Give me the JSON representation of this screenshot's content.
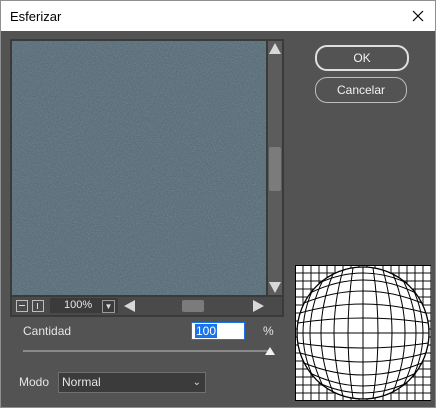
{
  "window": {
    "title": "Esferizar"
  },
  "buttons": {
    "ok_label": "OK",
    "cancel_label": "Cancelar"
  },
  "preview": {
    "zoom": "100%"
  },
  "amount": {
    "label": "Cantidad",
    "value": "100",
    "unit": "%",
    "slider_level_percent": 100
  },
  "mode": {
    "label": "Modo",
    "selected": "Normal"
  },
  "colors": {
    "dialog_background": "#535353",
    "preview_texture": "#5a7481",
    "titlebar": "#ffffff",
    "input_highlight": "#1a73e8"
  },
  "icons": {
    "close": "close-icon",
    "scroll_up": "up-arrow-icon",
    "scroll_down": "down-arrow-icon",
    "scroll_left": "left-arrow-icon",
    "scroll_right": "right-arrow-icon",
    "zoom_out": "zoom-out-icon",
    "zoom_in": "zoom-in-icon",
    "dropdown": "chevron-down-icon"
  }
}
